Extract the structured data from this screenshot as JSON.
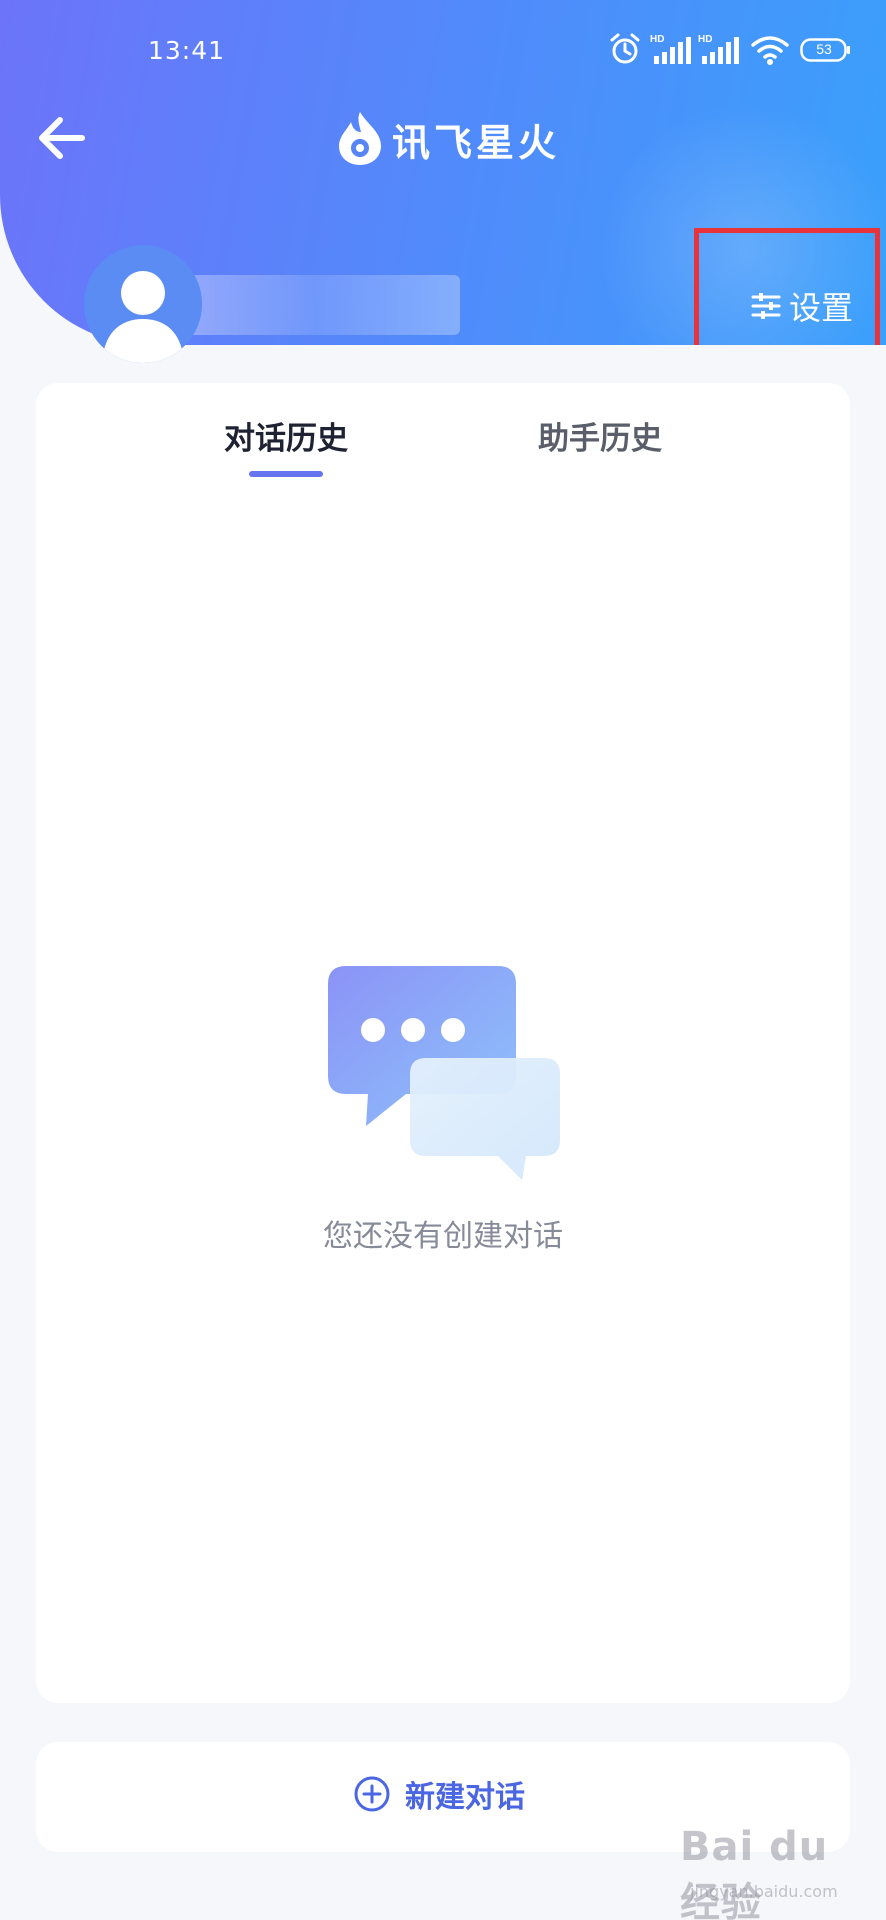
{
  "status_bar": {
    "time": "13:41",
    "battery": "53",
    "signal_badge": "HD"
  },
  "header": {
    "app_name": "讯飞星火",
    "username": "",
    "settings_label": "设置"
  },
  "tabs": [
    {
      "label": "对话历史",
      "active": true
    },
    {
      "label": "助手历史",
      "active": false
    }
  ],
  "empty_state": {
    "message": "您还没有创建对话"
  },
  "new_chat": {
    "label": "新建对话"
  },
  "watermark": {
    "brand": "Bai du 经验",
    "url": "jingyan.baidu.com"
  },
  "colors": {
    "header_start": "#6c74f9",
    "header_end": "#3aa0fb",
    "accent": "#4b66e2",
    "highlight_box": "#e8333a"
  }
}
